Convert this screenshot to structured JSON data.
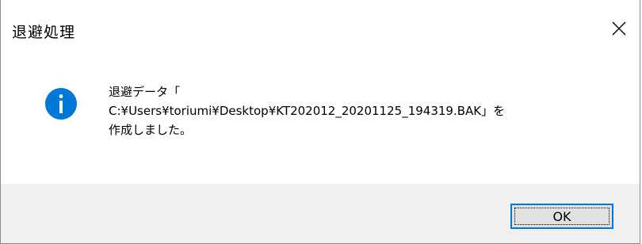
{
  "window": {
    "title": "退避処理",
    "close_label": "×"
  },
  "message": {
    "icon": "info-icon",
    "line1": "退避データ「",
    "line2": "C:¥Users¥toriumi¥Desktop¥KT202012_20201125_194319.BAK」を",
    "line3": "作成しました。"
  },
  "buttons": {
    "ok_label": "OK"
  },
  "colors": {
    "icon_blue": "#0078d7",
    "footer_bg": "#f0f0f0",
    "button_bg": "#e1e1e1",
    "button_border": "#0078d7"
  }
}
